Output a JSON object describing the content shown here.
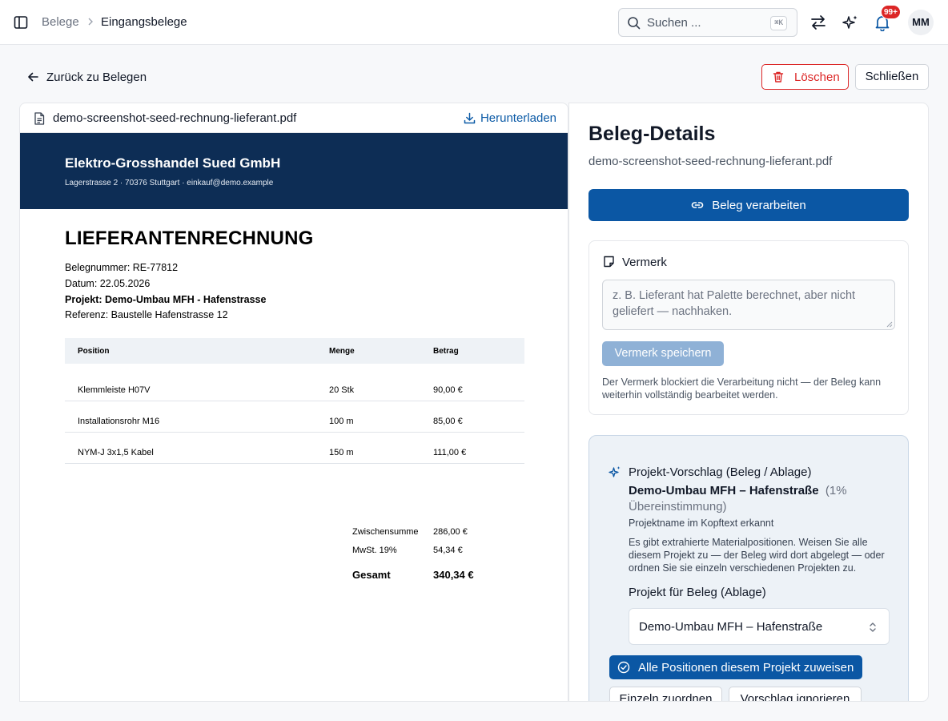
{
  "topbar": {
    "breadcrumb": [
      "Belege",
      "Eingangsbelege"
    ],
    "search_placeholder": "Suchen ...",
    "search_shortcut": "⌘K",
    "notification_count": "99+",
    "avatar_initials": "MM",
    "icons": [
      "sidebar-toggle-icon",
      "chevron-right-icon",
      "search-icon",
      "arrows-swap-icon",
      "sparkles-icon",
      "bell-icon"
    ]
  },
  "actions": {
    "back_label": "Zurück zu Belegen",
    "delete_label": "Löschen",
    "close_label": "Schließen",
    "accent_color": "#0b57a4",
    "danger_color": "#dc2626"
  },
  "preview": {
    "file_name": "demo-screenshot-seed-rechnung-lieferant.pdf",
    "download_label": "Herunterladen",
    "document": {
      "company": "Elektro-Grosshandel Sued GmbH",
      "address": "Lagerstrasse 2 · 70376 Stuttgart · einkauf@demo.example",
      "title": "LIEFERANTENRECHNUNG",
      "meta": [
        "Belegnummer: RE-77812",
        "Datum: 22.05.2026",
        "Projekt: Demo-Umbau MFH - Hafenstrasse",
        "Referenz: Baustelle Hafenstrasse 12"
      ],
      "columns": [
        "Position",
        "Menge",
        "Betrag"
      ],
      "rows": [
        [
          "Klemmleiste H07V",
          "20 Stk",
          "90,00 €"
        ],
        [
          "Installationsrohr M16",
          "100 m",
          "85,00 €"
        ],
        [
          "NYM-J 3x1,5 Kabel",
          "150 m",
          "111,00 €"
        ]
      ],
      "totals": [
        {
          "label": "Zwischensumme",
          "value": "286,00 €"
        },
        {
          "label": "MwSt. 19%",
          "value": "54,34 €"
        },
        {
          "label": "Gesamt",
          "value": "340,34 €"
        }
      ],
      "band_color": "#0d2d55"
    }
  },
  "details": {
    "title": "Beleg-Details",
    "file_name": "demo-screenshot-seed-rechnung-lieferant.pdf",
    "process_label": "Beleg verarbeiten",
    "note": {
      "title": "Vermerk",
      "placeholder": "z. B. Lieferant hat Palette berechnet, aber nicht geliefert — nachhaken.",
      "save_label": "Vermerk speichern",
      "hint": "Der Vermerk blockiert die Verarbeitung nicht — der Beleg kann weiterhin vollständig bearbeitet werden."
    },
    "suggestion": {
      "title": "Projekt-Vorschlag (Beleg / Ablage)",
      "project_name": "Demo-Umbau MFH – Hafenstraße",
      "match": "(1% Übereinstimmung)",
      "reason": "Projektname im Kopftext erkannt",
      "info": "Es gibt extrahierte Materialpositionen. Weisen Sie alle diesem Projekt zu — der Beleg wird dort abgelegt — oder ordnen Sie sie einzeln verschiedenen Projekten zu.",
      "select_label": "Projekt für Beleg (Ablage)",
      "select_value": "Demo-Umbau MFH – Hafenstraße",
      "assign_all_label": "Alle Positionen diesem Projekt zuweisen",
      "assign_single_label": "Einzeln zuordnen",
      "ignore_label": "Vorschlag ignorieren"
    }
  }
}
